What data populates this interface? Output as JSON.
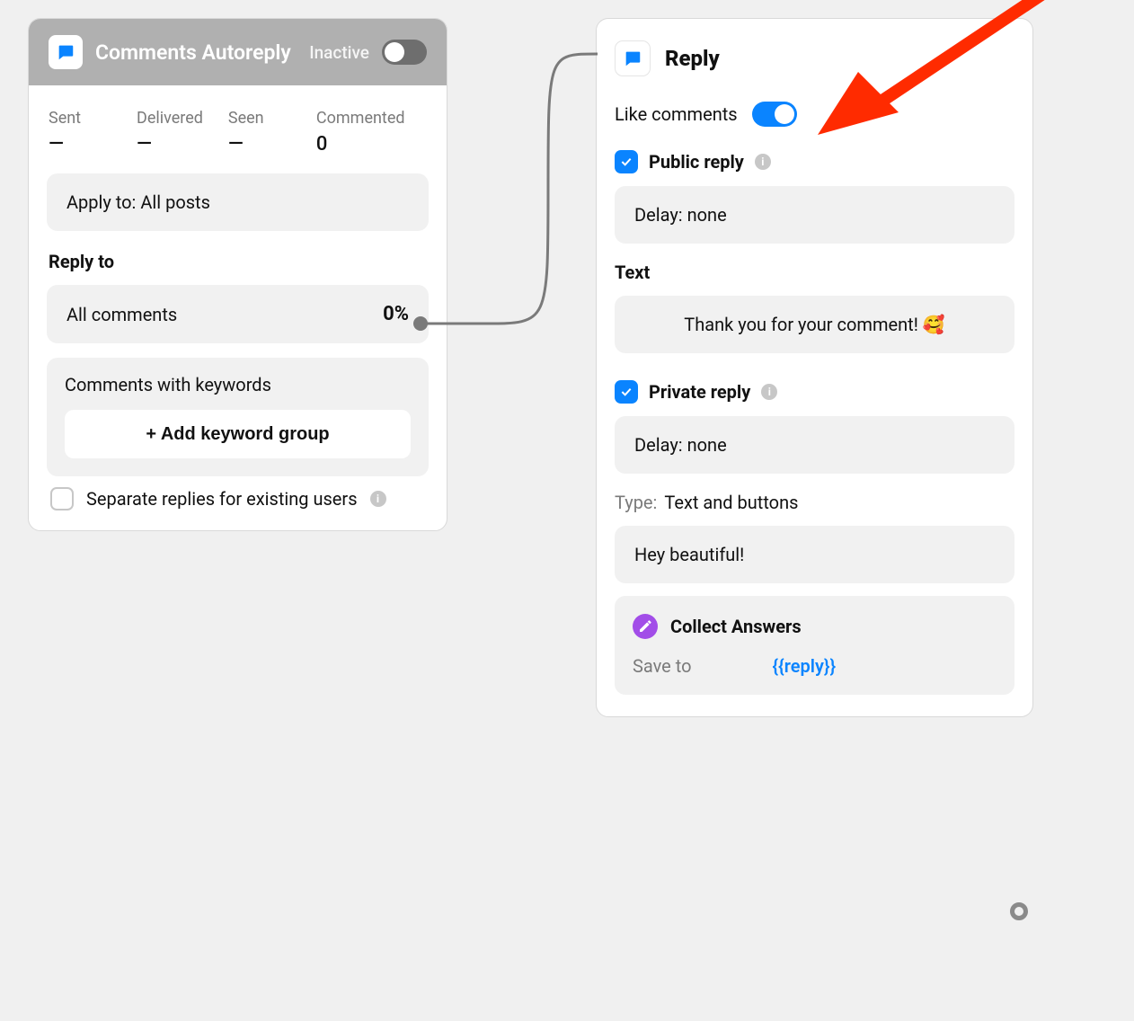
{
  "left": {
    "title": "Comments Autoreply",
    "status": "Inactive",
    "stats": {
      "sent": {
        "label": "Sent",
        "value": "—"
      },
      "delivered": {
        "label": "Delivered",
        "value": "—"
      },
      "seen": {
        "label": "Seen",
        "value": "—"
      },
      "commented": {
        "label": "Commented",
        "value": "0"
      }
    },
    "apply_to": "Apply to: All posts",
    "reply_to_label": "Reply to",
    "all_comments": {
      "label": "All comments",
      "pct": "0%"
    },
    "keywords": {
      "title": "Comments with keywords",
      "add_btn": "+ Add keyword group"
    },
    "separate_label": "Separate replies for existing users"
  },
  "right": {
    "title": "Reply",
    "like_label": "Like comments",
    "public": {
      "label": "Public reply",
      "delay": "Delay: none"
    },
    "text_label": "Text",
    "text_body": "Thank you for your comment! 🥰",
    "private": {
      "label": "Private reply",
      "delay": "Delay: none"
    },
    "type_label": "Type:",
    "type_value": "Text and buttons",
    "private_text": "Hey beautiful!",
    "collect": {
      "title": "Collect Answers",
      "save_label": "Save to",
      "save_value": "{{reply}}"
    }
  },
  "colors": {
    "accent": "#0a84ff",
    "arrow": "#ff2b00",
    "connector": "#7a7a7a"
  }
}
